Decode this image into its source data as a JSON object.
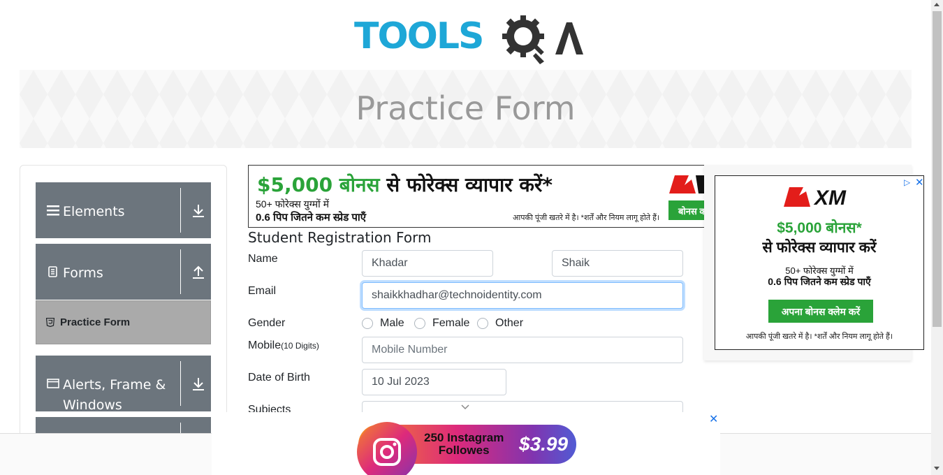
{
  "brand": {
    "logo_text": "TOOLS",
    "logo_suffix": "A"
  },
  "banner": {
    "title": "Practice Form"
  },
  "sidebar": {
    "groups": [
      {
        "label": "Elements",
        "icon": "hamburger-icon",
        "arrow": "download-arrow-icon"
      },
      {
        "label": "Forms",
        "icon": "document-icon",
        "arrow": "upload-arrow-icon"
      },
      {
        "label": "Alerts, Frame & Windows",
        "icon": "window-icon",
        "arrow": "download-arrow-icon"
      }
    ],
    "active_item": {
      "label": "Practice Form",
      "icon": "html5-icon"
    }
  },
  "top_ad": {
    "amount": "$5,000 बोनस",
    "headline_rest": " से फोरेक्स व्यापार करें*",
    "line1": "50+ फोरेक्स युग्मों में",
    "line2": "0.6 पिप जितने कम स्प्रेड पाएँ",
    "disclaimer": "आपकी पूंजी खतरे में है। *शर्तें और नियम लागू होते हैं।",
    "button": "बोनस क"
  },
  "form": {
    "title": "Student Registration Form",
    "name_label": "Name",
    "first_name": "Khadar",
    "last_name": "Shaik",
    "email_label": "Email",
    "email_value": "shaikkhadhar@technoidentity.com",
    "gender_label": "Gender",
    "gender_options": [
      "Male",
      "Female",
      "Other"
    ],
    "mobile_label": "Mobile",
    "mobile_hint": "(10 Digits)",
    "mobile_placeholder": "Mobile Number",
    "dob_label": "Date of Birth",
    "dob_value": "10 Jul 2023",
    "subjects_label": "Subjects"
  },
  "right_ad": {
    "brand": "XM",
    "amount": "$5,000 बोनस*",
    "headline": "से फोरेक्स व्यापार करें",
    "line1": "50+ फोरेक्स युग्मों में",
    "line2": "0.6 पिप जितने कम स्प्रेड पाएँ",
    "button": "अपना बोनस क्लेम करें",
    "disclaimer": "आपकी पूंजी खतरे में है। *शर्तें और नियम लागू होते हैं।"
  },
  "bottom_ad": {
    "line1": "250 Instagram",
    "line2": "Followes",
    "price": "$3.99"
  },
  "colors": {
    "accent": "#1ea7d7",
    "sidebar": "#6c757d",
    "ad_green": "#2aa339"
  }
}
